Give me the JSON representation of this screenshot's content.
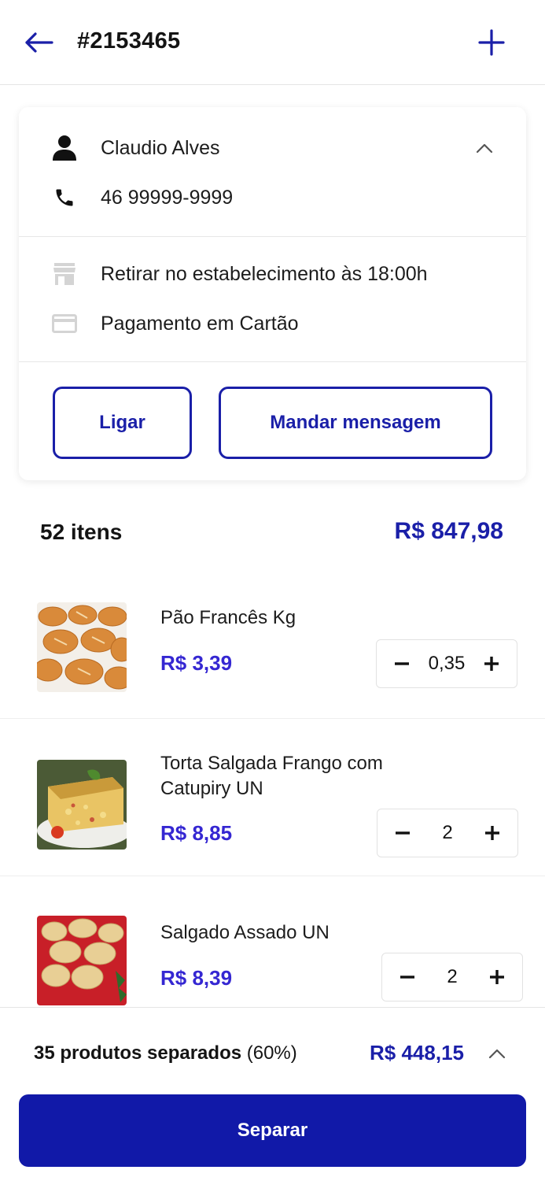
{
  "header": {
    "title": "#2153465",
    "back_icon": "arrow-left-icon",
    "add_icon": "plus-icon"
  },
  "customer": {
    "name": "Claudio Alves",
    "phone": "46 99999-9999",
    "pickup": "Retirar no estabelecimento às 18:00h",
    "payment": "Pagamento em Cartão"
  },
  "actions": {
    "call_label": "Ligar",
    "message_label": "Mandar mensagem"
  },
  "summary": {
    "count": "52 itens",
    "total": "R$ 847,98"
  },
  "products": [
    {
      "name": "Pão Francês Kg",
      "price": "R$ 3,39",
      "qty": "0,35"
    },
    {
      "name": "Torta Salgada Frango com Catupiry UN",
      "price": "R$ 8,85",
      "qty": "2"
    },
    {
      "name": "Salgado Assado UN",
      "price": "R$ 8,39",
      "qty": "2"
    }
  ],
  "footer": {
    "selected_bold": "35 produtos separados",
    "selected_pct": " (60%)",
    "selected_total": "R$ 448,15",
    "primary_label": "Separar"
  },
  "colors": {
    "accent": "#1a1fa8",
    "price": "#3527d2",
    "primary_button": "#1119a8"
  }
}
